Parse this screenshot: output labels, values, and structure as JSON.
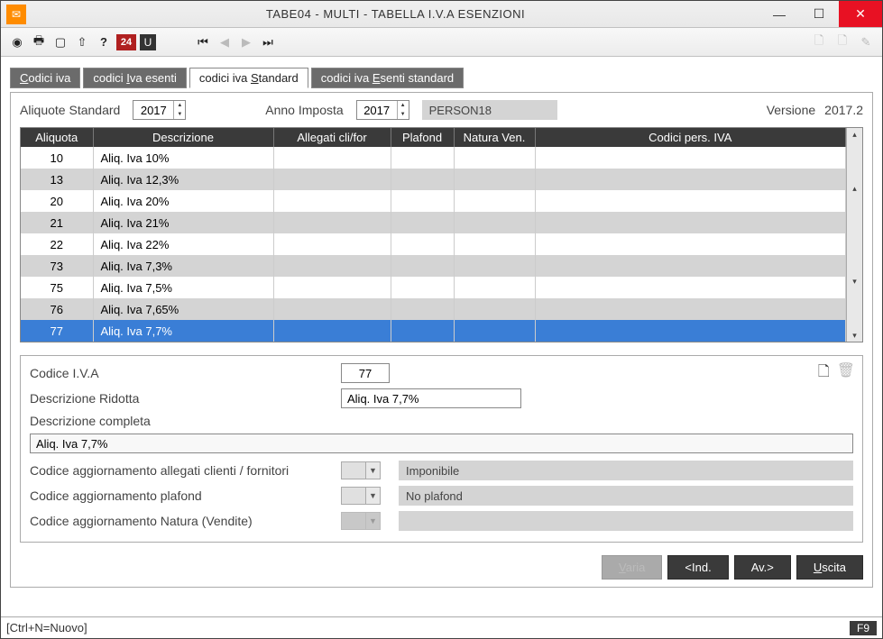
{
  "window": {
    "title": "TABE04  - MULTI -  TABELLA I.V.A ESENZIONI"
  },
  "toolbar": {
    "icons": {
      "camera": "camera-icon",
      "print": "print-icon",
      "folder": "folder-icon",
      "upload": "upload-icon",
      "help": "?",
      "num": "24",
      "util": "U"
    }
  },
  "tabs": {
    "t1_pre": "",
    "t1_u": "C",
    "t1_post": "odici iva",
    "t2_pre": "codici ",
    "t2_u": "I",
    "t2_post": "va esenti",
    "t3_pre": "codici iva ",
    "t3_u": "S",
    "t3_post": "tandard",
    "t4_pre": "codici iva ",
    "t4_u": "E",
    "t4_post": "senti standard"
  },
  "filters": {
    "lbl_std": "Aliquote Standard",
    "year_std": "2017",
    "lbl_anno": "Anno Imposta",
    "year_imp": "2017",
    "person": "PERSON18",
    "lbl_ver": "Versione",
    "ver": "2017.2"
  },
  "grid": {
    "headers": {
      "aliq": "Aliquota",
      "desc": "Descrizione",
      "alleg": "Allegati cli/for",
      "plaf": "Plafond",
      "nat": "Natura Ven.",
      "pers": "Codici pers. IVA"
    },
    "rows": [
      {
        "aliq": "10",
        "desc": "Aliq. Iva 10%"
      },
      {
        "aliq": "13",
        "desc": "Aliq. Iva 12,3%"
      },
      {
        "aliq": "20",
        "desc": "Aliq. Iva 20%"
      },
      {
        "aliq": "21",
        "desc": "Aliq. Iva 21%"
      },
      {
        "aliq": "22",
        "desc": "Aliq. Iva 22%"
      },
      {
        "aliq": "73",
        "desc": "Aliq. Iva 7,3%"
      },
      {
        "aliq": "75",
        "desc": "Aliq. Iva 7,5%"
      },
      {
        "aliq": "76",
        "desc": "Aliq. Iva 7,65%"
      },
      {
        "aliq": "77",
        "desc": "Aliq. Iva 7,7%"
      }
    ],
    "selected_index": 8
  },
  "detail": {
    "lbl_code": "Codice I.V.A",
    "code": "77",
    "lbl_descr": "Descrizione Ridotta",
    "descr": "Aliq. Iva 7,7%",
    "lbl_descfull": "Descrizione completa",
    "descfull": "Aliq. Iva 7,7%",
    "lbl_alleg": "Codice aggiornamento allegati clienti / fornitori",
    "alleg_res": "Imponibile",
    "lbl_plaf": "Codice aggiornamento plafond",
    "plaf_res": "No plafond",
    "lbl_nat": "Codice aggiornamento Natura (Vendite)",
    "nat_res": ""
  },
  "buttons": {
    "varia_u": "V",
    "varia_post": "aria",
    "ind": "<Ind.",
    "av": "Av.>",
    "uscita_u": "U",
    "uscita_post": "scita"
  },
  "status": {
    "left": "[Ctrl+N=Nuovo]",
    "right": "F9"
  }
}
